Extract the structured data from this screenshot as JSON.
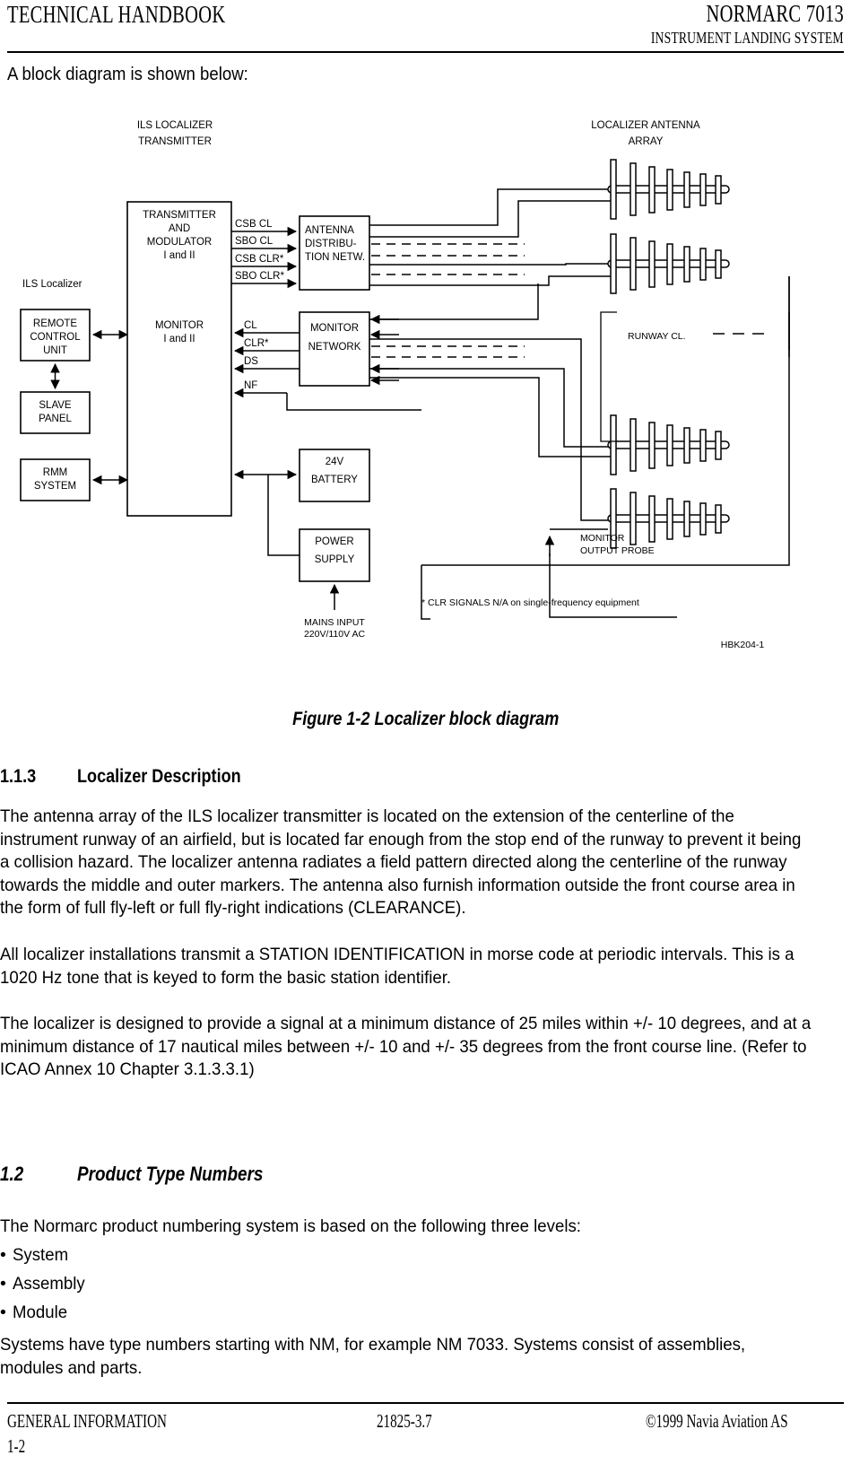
{
  "header": {
    "left_title": "TECHNICAL HANDBOOK",
    "right_title": "NORMARC 7013",
    "subtitle": "INSTRUMENT LANDING SYSTEM"
  },
  "intro": {
    "text": "A block diagram is shown below:"
  },
  "figure": {
    "caption": "Figure 1-2 Localizer block diagram",
    "drawing_id": "HBK204-1",
    "footnote": "* CLR SIGNALS N/A on single-frequency equipment",
    "titles": {
      "transmitter_group_line1": "ILS LOCALIZER",
      "transmitter_group_line2": "TRANSMITTER",
      "antenna_group_line1": "LOCALIZER ANTENNA",
      "antenna_group_line2": "ARRAY",
      "system_label": "ILS Localizer"
    },
    "blocks": {
      "remote_control": [
        "REMOTE",
        "CONTROL",
        "UNIT"
      ],
      "slave_panel": [
        "SLAVE",
        "PANEL"
      ],
      "rmm_system": [
        "RMM",
        "SYSTEM"
      ],
      "transmitter": [
        "TRANSMITTER",
        "AND",
        "MODULATOR",
        "I and II"
      ],
      "monitor_internal": [
        "MONITOR",
        "I and II"
      ],
      "antenna_distribution": [
        "ANTENNA",
        "DISTRIBU-",
        "TION NETW."
      ],
      "monitor_network": [
        "MONITOR",
        "NETWORK"
      ],
      "battery": [
        "24V",
        "BATTERY"
      ],
      "power_supply": [
        "POWER",
        "SUPPLY"
      ]
    },
    "signals_out": [
      "CSB CL",
      "SBO CL",
      "CSB CLR*",
      "SBO CLR*"
    ],
    "signals_in": [
      "CL",
      "CLR*",
      "DS",
      "NF"
    ],
    "annotations": {
      "runway_centerline": "RUNWAY CL.",
      "monitor_probe_line1": "MONITOR",
      "monitor_probe_line2": "OUTPUT PROBE",
      "mains_line1": "MAINS INPUT",
      "mains_line2": "220V/110V AC"
    }
  },
  "sections": [
    {
      "number": "1.1.3",
      "title": "Localizer Description",
      "style": "bold"
    },
    {
      "number": "1.2",
      "title": "Product Type Numbers",
      "style": "bold-italic"
    }
  ],
  "paragraphs": {
    "p1": "The antenna array of the ILS localizer transmitter is located on the extension of the centerline of the instrument runway of an airfield, but is located far enough from the stop end of the runway to prevent it being a collision hazard. The localizer antenna radiates a field pattern directed along the centerline of the runway towards the middle and outer markers. The antenna also furnish information outside the front course area in the form of full fly-left or full fly-right indications (CLEARANCE).",
    "p2": "All localizer installations transmit a STATION IDENTIFICATION in morse code at periodic intervals. This is a 1020 Hz tone that is keyed to form the basic station identifier.",
    "p3": "The localizer is designed to provide a signal at a minimum distance of 25 miles within +/- 10 degrees, and at a minimum distance of 17 nautical miles between +/- 10 and +/- 35 degrees from the front course line. (Refer to ICAO Annex 10 Chapter 3.1.3.3.1)",
    "p4": "The Normarc product numbering system is based on the following three levels:",
    "p5": "Systems have type numbers starting with NM, for example NM 7033. Systems consist of assemblies, modules and parts."
  },
  "bullets": [
    "System",
    "Assembly",
    "Module"
  ],
  "footer": {
    "left": "GENERAL INFORMATION",
    "middle": "21825-3.7",
    "right": "©1999 Navia Aviation AS",
    "page": "1-2"
  }
}
